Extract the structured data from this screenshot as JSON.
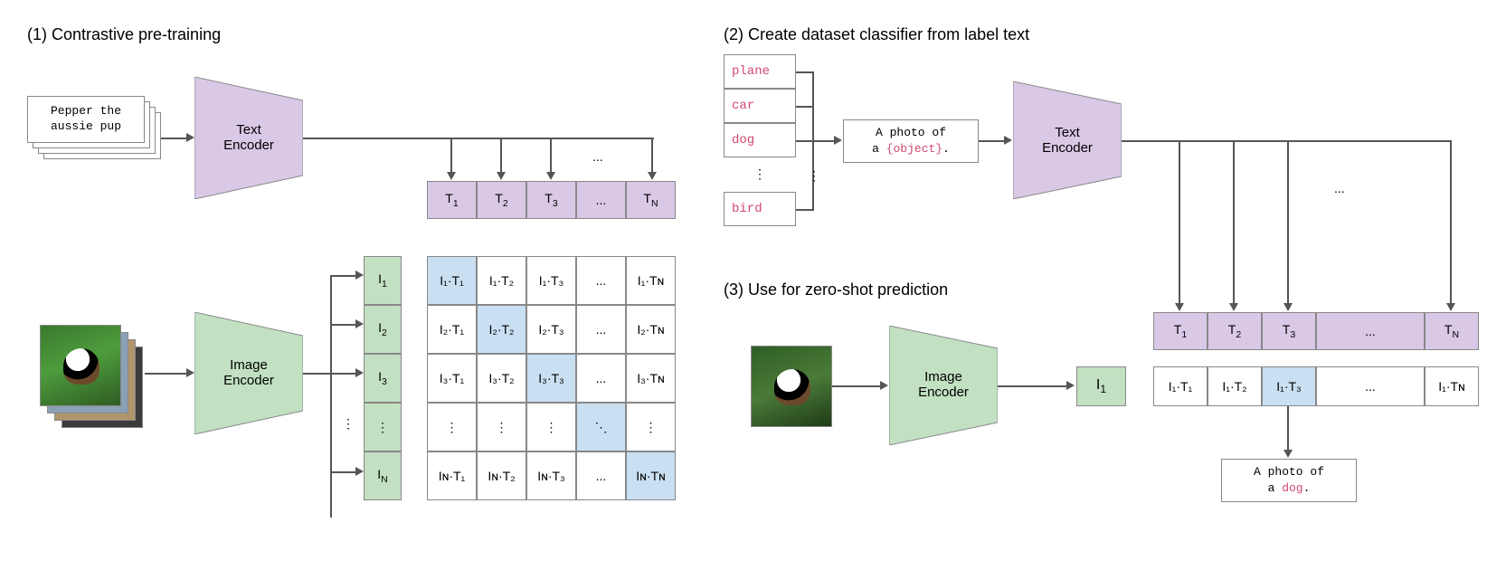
{
  "section1": {
    "title": "(1) Contrastive pre-training"
  },
  "section2": {
    "title": "(2) Create dataset classifier from label text"
  },
  "section3": {
    "title": "(3) Use for zero-shot prediction"
  },
  "caption": {
    "text": "Pepper the\naussie pup"
  },
  "encoders": {
    "text": "Text\nEncoder",
    "image": "Image\nEncoder"
  },
  "text_row": {
    "t1": "T",
    "t2": "T",
    "t3": "T",
    "tn": "T",
    "sub1": "1",
    "sub2": "2",
    "sub3": "3",
    "subn": "N",
    "dots": "..."
  },
  "img_col": {
    "i1": "I",
    "i2": "I",
    "i3": "I",
    "in": "I",
    "sub1": "1",
    "sub2": "2",
    "sub3": "3",
    "subn": "N",
    "dots": "⋮"
  },
  "matrix": {
    "r1": {
      "c1": "I₁·T₁",
      "c2": "I₁·T₂",
      "c3": "I₁·T₃",
      "c4": "...",
      "c5": "I₁·Tɴ"
    },
    "r2": {
      "c1": "I₂·T₁",
      "c2": "I₂·T₂",
      "c3": "I₂·T₃",
      "c4": "...",
      "c5": "I₂·Tɴ"
    },
    "r3": {
      "c1": "I₃·T₁",
      "c2": "I₃·T₂",
      "c3": "I₃·T₃",
      "c4": "...",
      "c5": "I₃·Tɴ"
    },
    "r4": {
      "c1": "⋮",
      "c2": "⋮",
      "c3": "⋮",
      "c4": "⋱",
      "c5": "⋮"
    },
    "r5": {
      "c1": "Iɴ·T₁",
      "c2": "Iɴ·T₂",
      "c3": "Iɴ·T₃",
      "c4": "...",
      "c5": "Iɴ·Tɴ"
    }
  },
  "labels": {
    "plane": "plane",
    "car": "car",
    "dog": "dog",
    "bird": "bird",
    "vdots": "⋮"
  },
  "prompt": {
    "line1": "A photo of",
    "line2a": "a ",
    "token": "{object}",
    "line2b": "."
  },
  "result": {
    "line1": "A photo of",
    "line2a": "a ",
    "token": "dog",
    "line2b": "."
  },
  "text_row2": {
    "t1": "T",
    "t2": "T",
    "t3": "T",
    "tn": "T",
    "sub1": "1",
    "sub2": "2",
    "sub3": "3",
    "subn": "N",
    "dots": "..."
  },
  "embed2": {
    "i": "I",
    "sub": "1"
  },
  "score_row": {
    "c1": "I₁·T₁",
    "c2": "I₁·T₂",
    "c3": "I₁·T₃",
    "c4": "...",
    "c5": "I₁·Tɴ"
  }
}
